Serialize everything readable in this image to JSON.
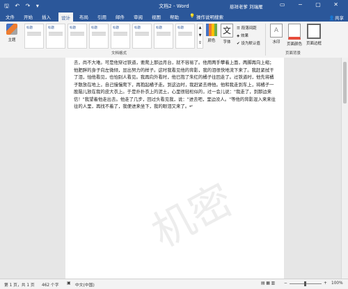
{
  "titlebar": {
    "quick_access": "🖫 ↶ ↷ ▾",
    "doc_title": "文档2 - Word",
    "user": "慈祥老爹 刘瑞雁",
    "window_controls": "▭ − ▢ ✕"
  },
  "tabs": [
    "文件",
    "开始",
    "插入",
    "设计",
    "布局",
    "引用",
    "邮件",
    "审阅",
    "视图",
    "帮助"
  ],
  "active_tab": "设计",
  "tell_me": "操作说明搜索",
  "share": "共享",
  "ribbon": {
    "theme_label": "主题",
    "style_titles": [
      "标题",
      "标题",
      "标题",
      "标题",
      "标题",
      "标题",
      "标题",
      "标题"
    ],
    "group_doc_format": "文档格式",
    "colors_label": "颜色",
    "fonts_label": "字体",
    "para_spacing": "段落间距",
    "effects": "效果",
    "set_default": "设为默认值",
    "watermark_label": "水印",
    "page_color": "页面颜色",
    "page_border": "页面边框",
    "group_page_bg": "页面背景"
  },
  "document": {
    "text": "去，尚不大难。可是他穿过铁道，要爬上那边月台，就不容易了。他用两手攀着上面，两脚再向上缩；他肥胖的身子向左微倾，显出努力的样子。这时我看见他的背影，我的泪很快地流下来了。我赶紧拭干了泪，怕他看见，也怕别人看见。我再向外看时，他已抱了朱红的橘子往回走了。过铁道时，他先将橘子散放在地上，自己慢慢爬下，再抱起橘子走。到这边时，我赶紧去搀他。他和我走到车上，将橘子一股脑儿放在我的皮大衣上。于是扑扑衣上的泥土，心里很轻松似的，过一会儿说：\"我走了，到那边来信！\"我望着他走出去。他走了几步，回过头看见我，说：\"进去吧，里边没人。\"等他的背影混入来来往往的人里，再找不着了，我便进来坐下，我的眼泪又来了。↵",
    "watermark": "机密"
  },
  "status": {
    "page": "第 1 页，共 1 页",
    "words": "462 个字",
    "lang": "中文(中国)",
    "zoom": "100%"
  },
  "colors": {
    "accent": "#2b579a"
  }
}
